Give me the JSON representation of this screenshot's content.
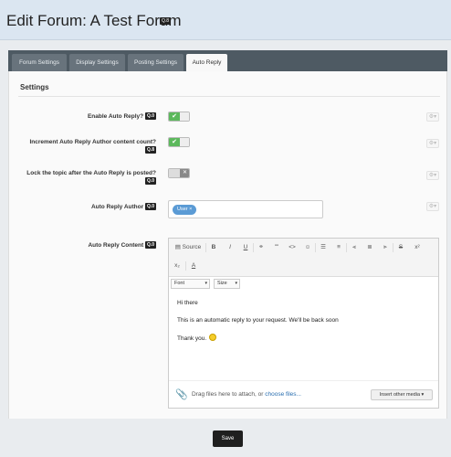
{
  "header": {
    "title": "Edit Forum: A Test Forum",
    "badge": "Q.8"
  },
  "tabs": [
    {
      "label": "Forum Settings"
    },
    {
      "label": "Display Settings"
    },
    {
      "label": "Posting Settings"
    },
    {
      "label": "Auto Reply",
      "active": true
    }
  ],
  "settings": {
    "heading": "Settings"
  },
  "rows": {
    "enable": {
      "label": "Enable Auto Reply?",
      "badge": "Q.0",
      "state": "on"
    },
    "increment": {
      "label": "Increment Auto Reply Author content count?",
      "badge": "Q.8",
      "state": "on"
    },
    "lock": {
      "label": "Lock the topic after the Auto Reply is posted?",
      "badge": "Q.0",
      "state": "off"
    },
    "author": {
      "label": "Auto Reply Author",
      "badge": "Q.0",
      "chip": "User ×"
    },
    "content": {
      "label": "Auto Reply Content",
      "badge": "Q.0"
    }
  },
  "toolbar": {
    "source": "Source",
    "bold": "B",
    "italic": "I",
    "underline": "U",
    "link": "⚭",
    "quote": "\"\"",
    "code": "<>",
    "emoji": "☺",
    "subscript": "x₂",
    "superscript": "x²",
    "strike": "S",
    "clear_format": "A",
    "font": "Font",
    "size": "Size"
  },
  "content": {
    "line1": "Hi there",
    "line2": "This is an automatic reply to your request. We'll be back soon",
    "line3": "Thank you."
  },
  "attach": {
    "text": "Drag files here to attach, or ",
    "link": "choose files...",
    "insert_media": "Insert other media ▾"
  },
  "footer": {
    "save_label": "Save"
  },
  "colors": {
    "accent": "#5cb85c",
    "header": "#dbe6f1",
    "tabbar": "#4e5a63",
    "chip": "#5b9bd5"
  }
}
